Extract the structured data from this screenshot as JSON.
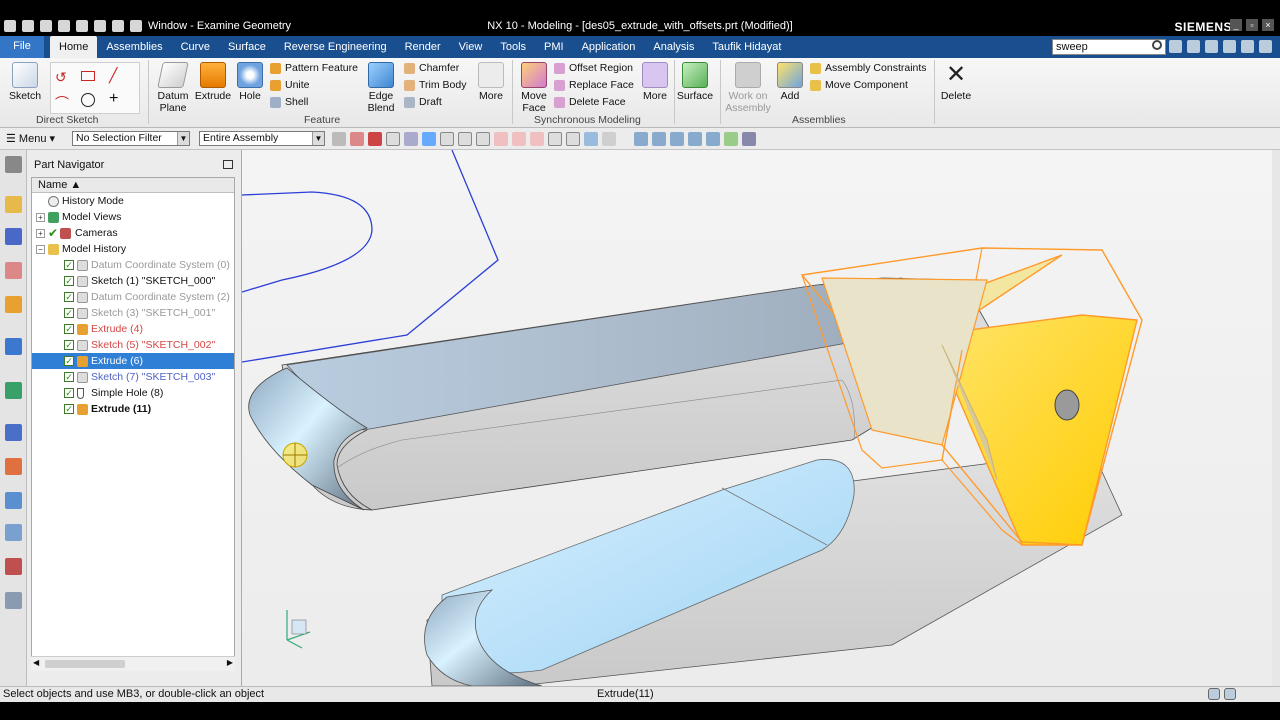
{
  "title": {
    "window_menu": "Window - Examine Geometry",
    "caption": "NX 10 - Modeling - [des05_extrude_with_offsets.prt (Modified)]",
    "brand": "SIEMENS"
  },
  "tabs": {
    "file": "File",
    "items": [
      "Home",
      "Assemblies",
      "Curve",
      "Surface",
      "Reverse Engineering",
      "Render",
      "View",
      "Tools",
      "PMI",
      "Application",
      "Analysis",
      "Taufik Hidayat"
    ],
    "search_value": "sweep"
  },
  "ribbon": {
    "sketch": "Sketch",
    "direct_sketch": "Direct Sketch",
    "datum_plane": "Datum Plane",
    "extrude": "Extrude",
    "hole": "Hole",
    "pattern_feature": "Pattern Feature",
    "unite": "Unite",
    "shell": "Shell",
    "edge_blend": "Edge Blend",
    "chamfer": "Chamfer",
    "trim_body": "Trim Body",
    "draft": "Draft",
    "more1": "More",
    "feature": "Feature",
    "move_face": "Move Face",
    "offset_region": "Offset Region",
    "replace_face": "Replace Face",
    "delete_face": "Delete Face",
    "more2": "More",
    "synchronous_modeling": "Synchronous Modeling",
    "surface": "Surface",
    "work_on_assembly": "Work on Assembly",
    "add": "Add",
    "assembly_constraints": "Assembly Constraints",
    "move_component": "Move Component",
    "assemblies": "Assemblies",
    "delete": "Delete"
  },
  "toolbar": {
    "menu": "Menu",
    "selection_filter": "No Selection Filter",
    "scope": "Entire Assembly"
  },
  "navigator": {
    "title": "Part Navigator",
    "column": "Name",
    "rows": [
      {
        "label": "History Mode"
      },
      {
        "label": "Model Views"
      },
      {
        "label": "Cameras"
      },
      {
        "label": "Model History"
      },
      {
        "label": "Datum Coordinate System (0)"
      },
      {
        "label": "Sketch (1) \"SKETCH_000\""
      },
      {
        "label": "Datum Coordinate System (2)"
      },
      {
        "label": "Sketch (3) \"SKETCH_001\""
      },
      {
        "label": "Extrude (4)"
      },
      {
        "label": "Sketch (5) \"SKETCH_002\""
      },
      {
        "label": "Extrude (6)"
      },
      {
        "label": "Sketch (7) \"SKETCH_003\""
      },
      {
        "label": "Simple Hole (8)"
      },
      {
        "label": "Extrude (11)"
      }
    ]
  },
  "status": {
    "prompt": "Select objects and use MB3, or double-click an object",
    "selection": "Extrude(11)"
  },
  "colors": {
    "accent": "#1a4f8f",
    "selection": "#2f7fd6",
    "highlight": "#ffd200",
    "preview_edge": "#ff9a2a"
  }
}
